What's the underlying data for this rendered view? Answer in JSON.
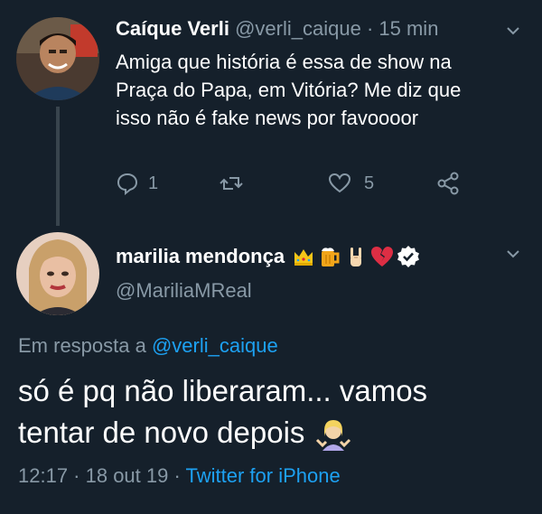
{
  "first_tweet": {
    "author_name": "Caíque Verli",
    "handle": "@verli_caique",
    "separator": "·",
    "time": "15 min",
    "text_lines": [
      "Amiga que história é essa de show na",
      "Praça do Papa, em Vitória? Me diz que",
      "isso não é fake news por favoooor"
    ],
    "reply_count": "1",
    "retweet_count": "",
    "like_count": "5",
    "colors": {
      "background": "#15202b",
      "muted": "#8899a6",
      "line": "#38444d"
    }
  },
  "reply_tweet": {
    "author_name": "marilia mendonça",
    "name_emojis": [
      "crown-icon",
      "beer-mug-icon",
      "rock-hand-icon",
      "broken-heart-icon"
    ],
    "verified": true,
    "handle": "@MariliaMReal",
    "in_reply_prefix": "Em resposta a",
    "in_reply_handle": "@verli_caique",
    "text_lines": [
      "só é pq não liberaram... vamos",
      "tentar de novo depois"
    ],
    "text_emoji": "person-shrugging-icon",
    "timestamp": "12:17 · 18 out 19",
    "separator": "·",
    "source": "Twitter for iPhone",
    "colors": {
      "link": "#1da1f2",
      "verified_badge": "#ffffff"
    }
  }
}
